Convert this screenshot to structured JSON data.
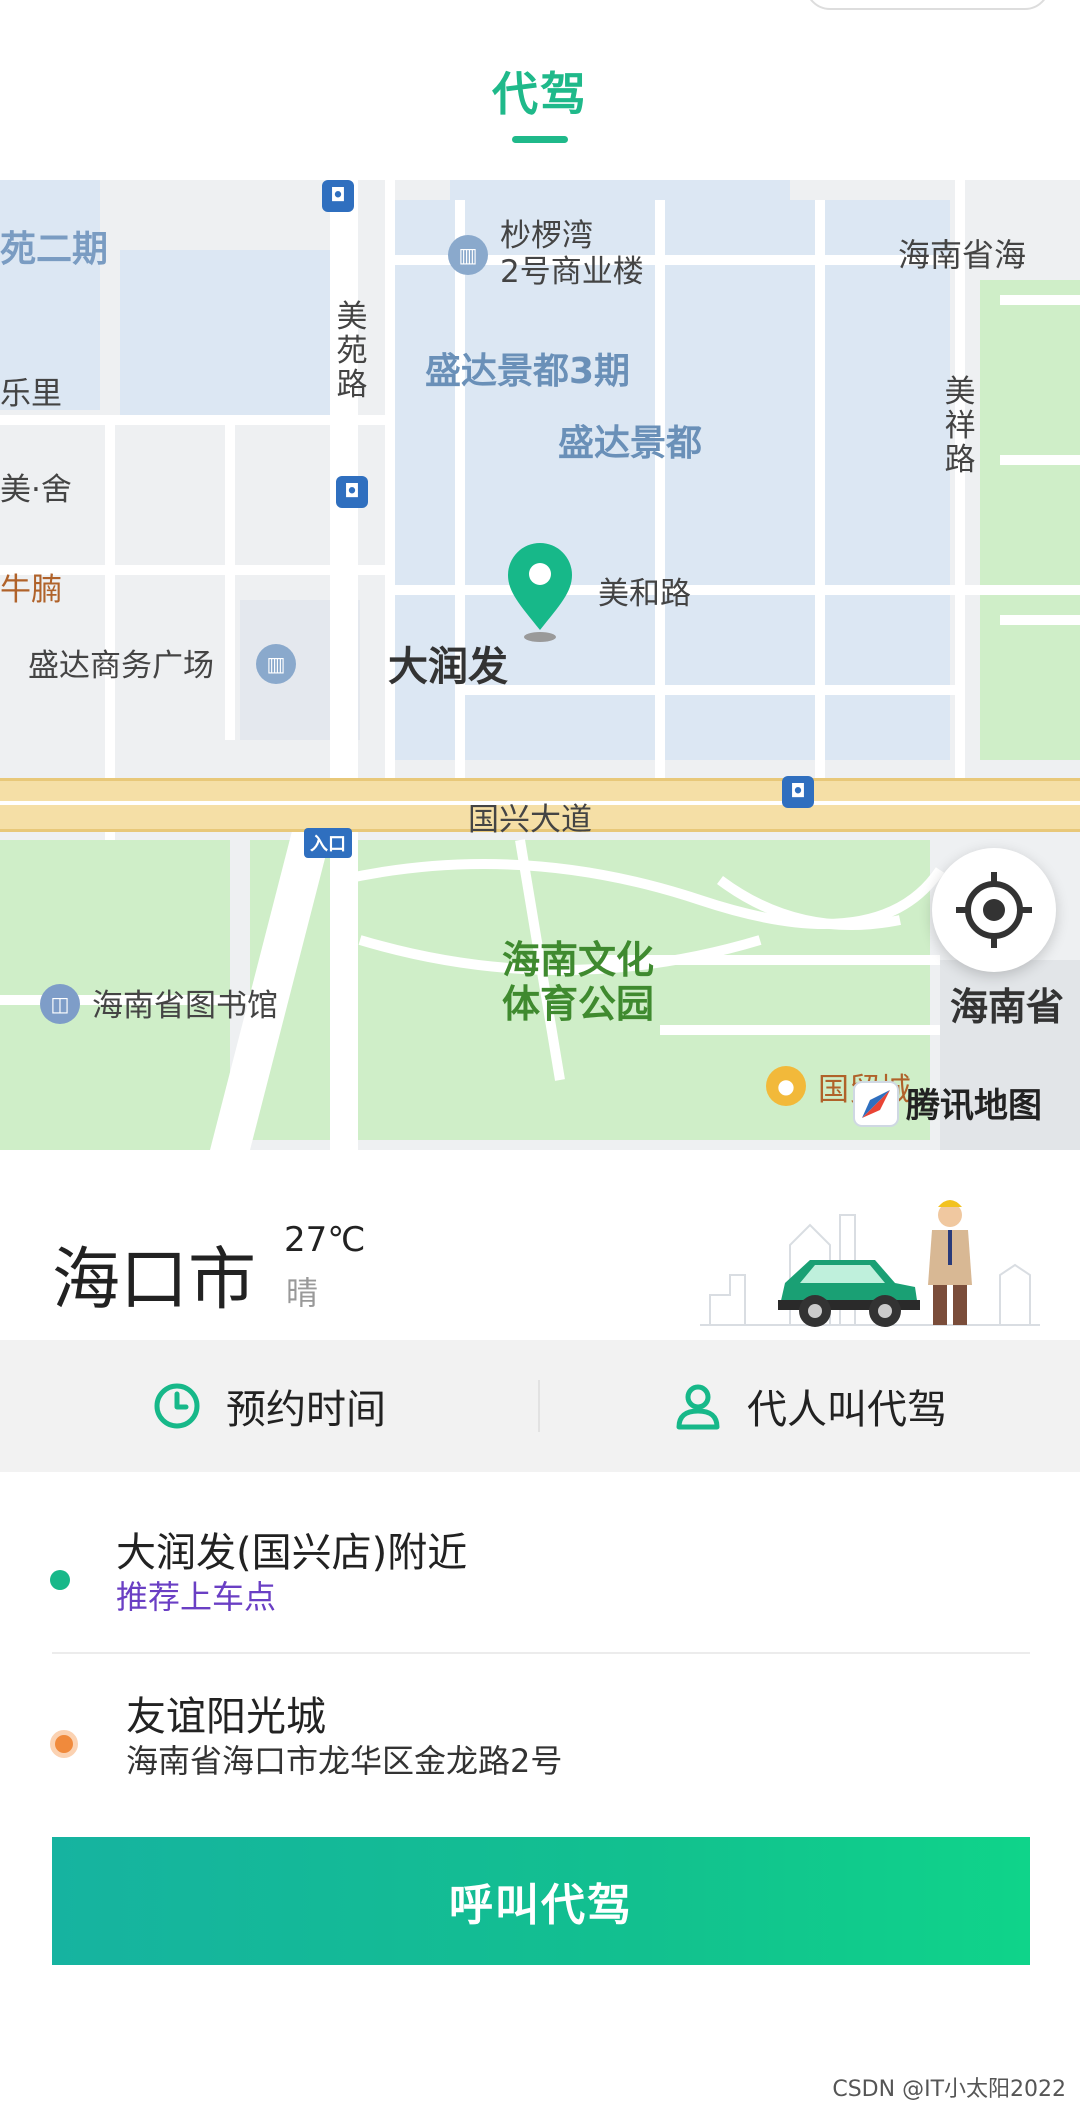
{
  "header": {
    "tab_title": "代驾"
  },
  "map": {
    "labels": {
      "yuan_phase2": "苑二期",
      "li": "乐里",
      "mei_she": "美·舍",
      "niu_nan": "牛腩",
      "shaluo_wan": "杪椤湾\n2号商业楼",
      "haina_prov": "海南省海",
      "meiyuan_road": "美\n苑\n路",
      "shengda_3": "盛达景都3期",
      "shengda": "盛达景都",
      "meixiang_road": "美\n祥\n路",
      "meihe_road": "美和路",
      "shengda_plaza": "盛达商务广场",
      "darunfa": "大润发",
      "guoxing_avenue": "国兴大道",
      "entry": "入口",
      "park": "海南文化\n体育公园",
      "library": "海南省图书馆",
      "hainan_prov2": "海南省",
      "guomao": "国贸城"
    },
    "brand": "腾讯地图",
    "icons": {
      "locate": "locate-icon",
      "pin": "map-pin-icon",
      "compass": "tencent-map-logo-icon"
    }
  },
  "city": {
    "name": "海口市",
    "temperature": "27℃",
    "weather": "晴"
  },
  "options": {
    "reserve_time": "预约时间",
    "call_for_others": "代人叫代驾"
  },
  "route": {
    "start": {
      "title": "大润发(国兴店)附近",
      "subtitle": "推荐上车点"
    },
    "end": {
      "title": "友谊阳光城",
      "subtitle": "海南省海口市龙华区金龙路2号"
    }
  },
  "call_button": {
    "label": "呼叫代驾"
  },
  "watermark": "CSDN @IT小太阳2022",
  "colors": {
    "brand_green": "#1fb98a",
    "start_dot": "#17b889",
    "end_dot": "#f08a3c",
    "link_purple": "#6a3fc4"
  }
}
